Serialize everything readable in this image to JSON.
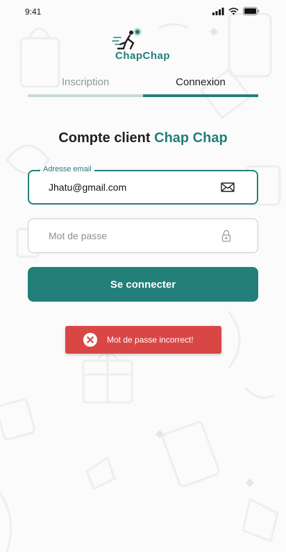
{
  "status_bar": {
    "time": "9:41"
  },
  "logo": {
    "text": "ChapChap"
  },
  "tabs": [
    {
      "label": "Inscription",
      "active": false
    },
    {
      "label": "Connexion",
      "active": true
    }
  ],
  "heading": {
    "prefix": "Compte client",
    "brand": "Chap Chap"
  },
  "email_field": {
    "label": "Adresse email",
    "value": "Jhatu@gmail.com",
    "icon": "mail-icon"
  },
  "password_field": {
    "placeholder": "Mot de passe",
    "value": "",
    "icon": "lock-icon"
  },
  "login_button": {
    "label": "Se connecter"
  },
  "toast": {
    "message": "Mot de passe incorrect!",
    "icon": "close-circle-icon"
  },
  "colors": {
    "accent": "#227f7a",
    "accent_light": "#c8dad8",
    "error": "#d94646"
  }
}
